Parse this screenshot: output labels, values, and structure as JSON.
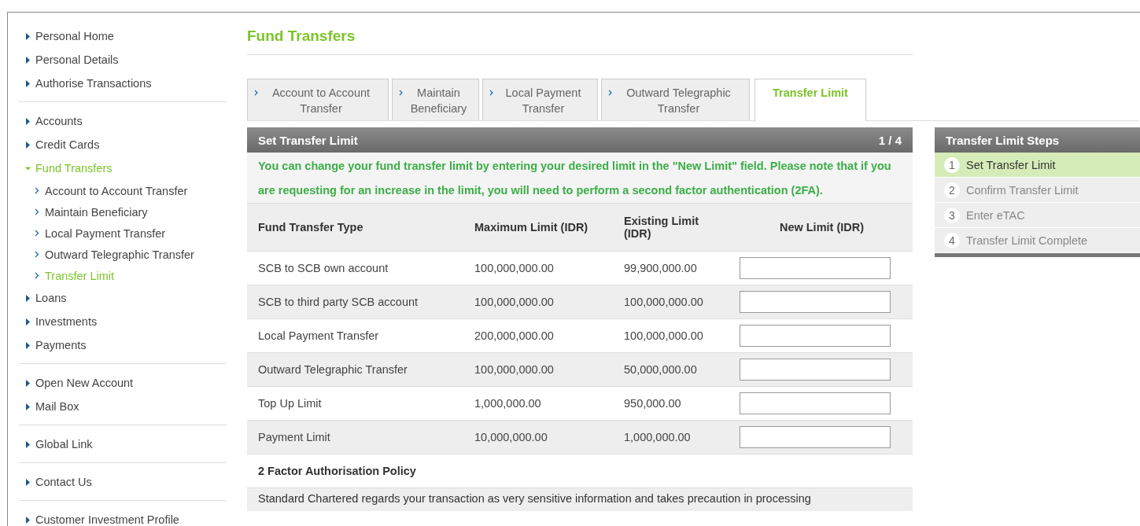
{
  "sidebar": {
    "groups": [
      {
        "items": [
          {
            "label": "Personal Home",
            "expanded": false
          },
          {
            "label": "Personal Details",
            "expanded": false
          },
          {
            "label": "Authorise Transactions",
            "expanded": false
          }
        ]
      },
      {
        "items": [
          {
            "label": "Accounts",
            "expanded": false
          },
          {
            "label": "Credit Cards",
            "expanded": false
          },
          {
            "label": "Fund Transfers",
            "expanded": true,
            "children": [
              {
                "label": "Account to Account Transfer",
                "selected": false
              },
              {
                "label": "Maintain Beneficiary",
                "selected": false
              },
              {
                "label": "Local Payment Transfer",
                "selected": false
              },
              {
                "label": "Outward Telegraphic Transfer",
                "selected": false
              },
              {
                "label": "Transfer Limit",
                "selected": true
              }
            ]
          },
          {
            "label": "Loans",
            "expanded": false
          },
          {
            "label": "Investments",
            "expanded": false
          },
          {
            "label": "Payments",
            "expanded": false
          }
        ]
      },
      {
        "items": [
          {
            "label": "Open New Account",
            "expanded": false
          },
          {
            "label": "Mail Box",
            "expanded": false
          }
        ]
      },
      {
        "items": [
          {
            "label": "Global Link",
            "expanded": false
          }
        ]
      },
      {
        "items": [
          {
            "label": "Contact Us",
            "expanded": false
          }
        ]
      },
      {
        "items": [
          {
            "label": "Customer Investment Profile",
            "expanded": false
          }
        ]
      }
    ]
  },
  "page_title": "Fund Transfers",
  "tabs": [
    {
      "label": "Account to Account Transfer",
      "selected": false
    },
    {
      "label": "Maintain Beneficiary",
      "selected": false
    },
    {
      "label": "Local Payment Transfer",
      "selected": false
    },
    {
      "label": "Outward Telegraphic Transfer",
      "selected": false
    },
    {
      "label": "Transfer Limit",
      "selected": true
    }
  ],
  "panel": {
    "title": "Set Transfer Limit",
    "step": "1 / 4",
    "notice": "You can change your fund transfer limit by entering your desired limit in the \"New Limit\" field. Please note that if you are requesting for an increase in the limit, you will need to perform a second factor authentication (2FA).",
    "table": {
      "columns": [
        "Fund Transfer Type",
        "Maximum Limit (IDR)",
        "Existing Limit (IDR)",
        "New Limit (IDR)"
      ],
      "rows": [
        {
          "type": "SCB to SCB own account",
          "maximum": "100,000,000.00",
          "existing": "99,900,000.00"
        },
        {
          "type": "SCB to third party SCB account",
          "maximum": "100,000,000.00",
          "existing": "100,000,000.00"
        },
        {
          "type": "Local Payment Transfer",
          "maximum": "200,000,000.00",
          "existing": "100,000,000.00"
        },
        {
          "type": "Outward Telegraphic Transfer",
          "maximum": "100,000,000.00",
          "existing": "50,000,000.00"
        },
        {
          "type": "Top Up Limit",
          "maximum": "1,000,000.00",
          "existing": "950,000.00"
        },
        {
          "type": "Payment Limit",
          "maximum": "10,000,000.00",
          "existing": "1,000,000.00"
        }
      ]
    },
    "policy_title": "2 Factor Authorisation Policy",
    "policy_text": "Standard Chartered regards your transaction as very sensitive information and takes precaution in processing"
  },
  "steps": {
    "title": "Transfer Limit Steps",
    "items": [
      {
        "number": "1",
        "label": "Set Transfer Limit",
        "selected": true
      },
      {
        "number": "2",
        "label": "Confirm Transfer Limit",
        "selected": false
      },
      {
        "number": "3",
        "label": "Enter eTAC",
        "selected": false
      },
      {
        "number": "4",
        "label": "Transfer Limit Complete",
        "selected": false
      }
    ]
  }
}
